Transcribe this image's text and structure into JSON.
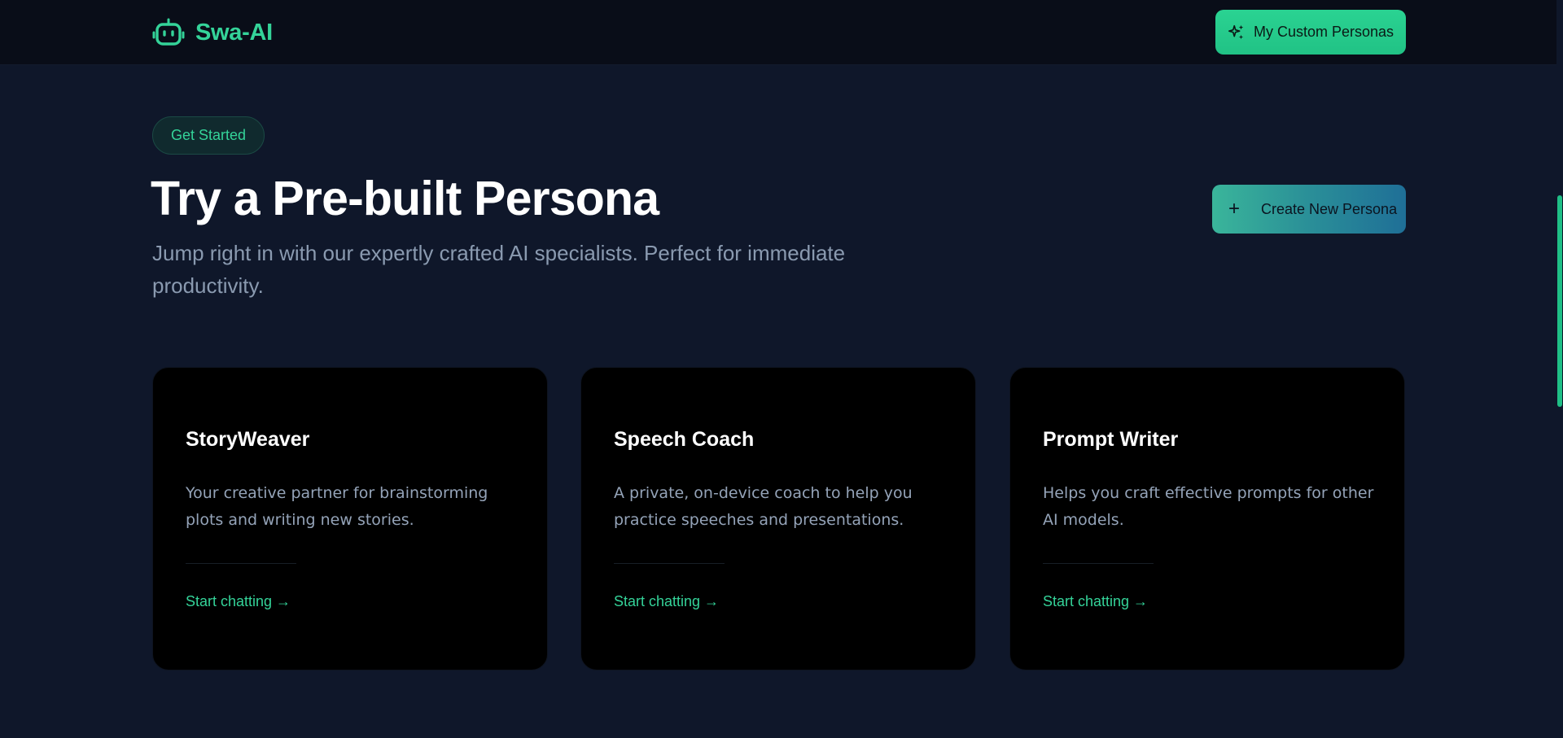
{
  "header": {
    "brand_name": "Swa-AI",
    "brand_icon": "robot-icon",
    "custom_personas_label": "My Custom Personas",
    "custom_personas_icon": "sparkles-icon"
  },
  "hero": {
    "badge": "Get Started",
    "title": "Try a Pre-built Persona",
    "subtitle": "Jump right in with our expertly crafted AI specialists. Perfect for immediate productivity.",
    "create_button_label": "Create New Persona",
    "create_button_icon": "plus-icon"
  },
  "personas": [
    {
      "name": "StoryWeaver",
      "description": "Your creative partner for brainstorming plots and writing new stories.",
      "link": "Start chatting →"
    },
    {
      "name": "Speech Coach",
      "description": "A private, on-device coach to help you practice speeches and presentations.",
      "link": "Start chatting →"
    },
    {
      "name": "Prompt Writer",
      "description": "Helps you craft effective prompts for other AI models.",
      "link": "Start chatting →"
    }
  ],
  "colors": {
    "background": "#0f172a",
    "header_background": "#090d18",
    "accent": "#34d399",
    "card_background": "#000000",
    "muted_text": "#94a3b8"
  }
}
